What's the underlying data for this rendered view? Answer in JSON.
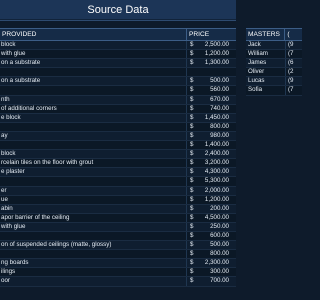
{
  "title": "Source Data",
  "main_table": {
    "headers": {
      "name": "PROVIDED",
      "price": "PRICE"
    },
    "rows": [
      {
        "name": "block",
        "cur": "$",
        "price": "2,500.00"
      },
      {
        "name": "with glue",
        "cur": "$",
        "price": "1,200.00"
      },
      {
        "name": "on a substrate",
        "cur": "$",
        "price": "1,300.00"
      },
      {
        "name": "",
        "cur": "",
        "price": ""
      },
      {
        "name": "on a substrate",
        "cur": "$",
        "price": "500.00"
      },
      {
        "name": "",
        "cur": "$",
        "price": "560.00"
      },
      {
        "name": "nth",
        "cur": "$",
        "price": "670.00"
      },
      {
        "name": "of additional corners",
        "cur": "$",
        "price": "740.00"
      },
      {
        "name": "e block",
        "cur": "$",
        "price": "1,450.00"
      },
      {
        "name": "",
        "cur": "$",
        "price": "800.00"
      },
      {
        "name": "ay",
        "cur": "$",
        "price": "980.00"
      },
      {
        "name": "",
        "cur": "$",
        "price": "1,400.00"
      },
      {
        "name": "block",
        "cur": "$",
        "price": "2,400.00"
      },
      {
        "name": "rcelain tiles on the floor with grout",
        "cur": "$",
        "price": "3,200.00"
      },
      {
        "name": "e plaster",
        "cur": "$",
        "price": "4,300.00"
      },
      {
        "name": "",
        "cur": "$",
        "price": "5,300.00"
      },
      {
        "name": "er",
        "cur": "$",
        "price": "2,000.00"
      },
      {
        "name": "ue",
        "cur": "$",
        "price": "1,200.00"
      },
      {
        "name": "abin",
        "cur": "$",
        "price": "200.00"
      },
      {
        "name": "apor barrier of the ceiling",
        "cur": "$",
        "price": "4,500.00"
      },
      {
        "name": "with glue",
        "cur": "$",
        "price": "250.00"
      },
      {
        "name": "",
        "cur": "$",
        "price": "600.00"
      },
      {
        "name": "on of suspended ceilings (matte, glossy)",
        "cur": "$",
        "price": "500.00"
      },
      {
        "name": "",
        "cur": "$",
        "price": "800.00"
      },
      {
        "name": "ng boards",
        "cur": "$",
        "price": "2,300.00"
      },
      {
        "name": "ilings",
        "cur": "$",
        "price": "300.00"
      },
      {
        "name": "oor",
        "cur": "$",
        "price": "700.00"
      }
    ]
  },
  "side_table": {
    "headers": {
      "name": "MASTERS",
      "amount": "("
    },
    "rows": [
      {
        "name": "Jack",
        "amount": "(9"
      },
      {
        "name": "William",
        "amount": "(7"
      },
      {
        "name": "James",
        "amount": "(6"
      },
      {
        "name": "Oliver",
        "amount": "(2"
      },
      {
        "name": "Lucas",
        "amount": "(9"
      },
      {
        "name": "Sofia",
        "amount": "(7"
      }
    ]
  }
}
